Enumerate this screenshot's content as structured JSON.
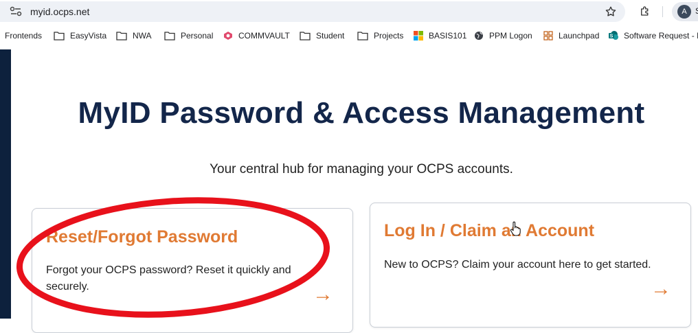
{
  "browser": {
    "url": "myid.ocps.net",
    "profile_initial": "A",
    "profile_name_fragment": "S"
  },
  "bookmarks": [
    {
      "label": "Frontends",
      "icon": "none"
    },
    {
      "label": "EasyVista",
      "icon": "folder-icon"
    },
    {
      "label": "NWA",
      "icon": "folder-icon"
    },
    {
      "label": "Personal",
      "icon": "folder-icon"
    },
    {
      "label": "COMMVAULT",
      "icon": "commvault-icon"
    },
    {
      "label": "Student",
      "icon": "folder-icon"
    },
    {
      "label": "Projects",
      "icon": "folder-icon"
    },
    {
      "label": "BASIS101",
      "icon": "windows-logo-icon"
    },
    {
      "label": "PPM Logon",
      "icon": "globe-icon"
    },
    {
      "label": "Launchpad",
      "icon": "launchpad-icon"
    },
    {
      "label": "Software Request - I",
      "icon": "sharepoint-icon"
    }
  ],
  "page": {
    "title": "MyID Password & Access Management",
    "subtitle": "Your central hub for managing your OCPS accounts.",
    "cards": [
      {
        "title": "Reset/Forgot Password",
        "description": "Forgot your OCPS password? Reset it quickly and securely.",
        "arrow": "→"
      },
      {
        "title": "Log In / Claim an Account",
        "description": "New to OCPS? Claim your account here to get started.",
        "arrow": "→"
      }
    ]
  },
  "colors": {
    "title": "#13264a",
    "accent": "#e07a33",
    "left_strip": "#0d213d",
    "annotation": "#e8111b"
  }
}
